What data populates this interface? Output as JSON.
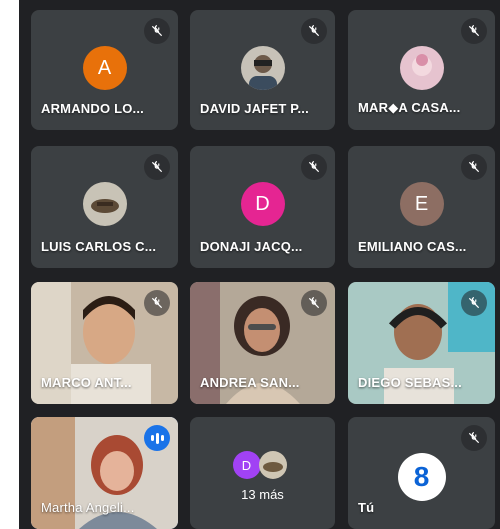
{
  "participants": [
    {
      "initial": "A",
      "name": "ARMANDO LO...",
      "avatar_color": "#e8710a",
      "muted": true
    },
    {
      "initial": "",
      "name": "DAVID JAFET P...",
      "avatar_color": "#c7c2b8",
      "muted": true
    },
    {
      "initial": "",
      "name": "MAR◆A CASA...",
      "avatar_color": "#e6c3cf",
      "muted": true
    },
    {
      "initial": "",
      "name": "LUIS CARLOS C...",
      "avatar_color": "#c8c3b6",
      "muted": true
    },
    {
      "initial": "D",
      "name": "DONAJI JACQ...",
      "avatar_color": "#e52592",
      "muted": true
    },
    {
      "initial": "E",
      "name": "EMILIANO CAS...",
      "avatar_color": "#8d6e63",
      "muted": true
    },
    {
      "name": "MARCO ANT...",
      "muted": true
    },
    {
      "name": "ANDREA SAN...",
      "muted": true
    },
    {
      "name": "DIEGO SEBAS...",
      "muted": true
    },
    {
      "name": "Martha Angeli...",
      "speaking": true
    }
  ],
  "others": {
    "initial": "D",
    "count_label": "13 más",
    "avatar_color": "#a142f4"
  },
  "self": {
    "name": "Tú",
    "logo_text": "8",
    "muted": true
  }
}
